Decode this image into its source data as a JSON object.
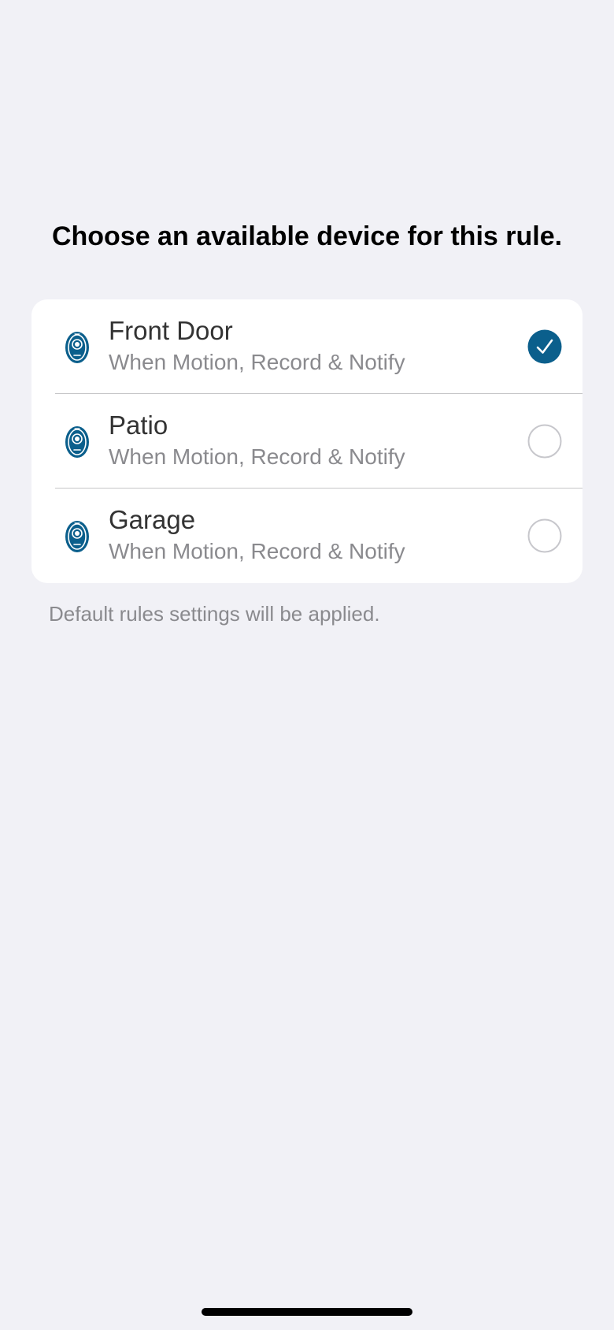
{
  "header": {
    "title": "Choose an available device for this rule."
  },
  "colors": {
    "accent": "#0b5f8c",
    "background": "#f1f1f6",
    "card": "#ffffff",
    "secondary_text": "#8a8a8e"
  },
  "devices": [
    {
      "name": "Front Door",
      "subtitle": "When Motion, Record & Notify",
      "icon": "camera-icon",
      "selected": true
    },
    {
      "name": "Patio",
      "subtitle": "When Motion, Record & Notify",
      "icon": "camera-icon",
      "selected": false
    },
    {
      "name": "Garage",
      "subtitle": "When Motion, Record & Notify",
      "icon": "camera-icon",
      "selected": false
    }
  ],
  "footer": {
    "note": "Default rules settings will be applied."
  }
}
